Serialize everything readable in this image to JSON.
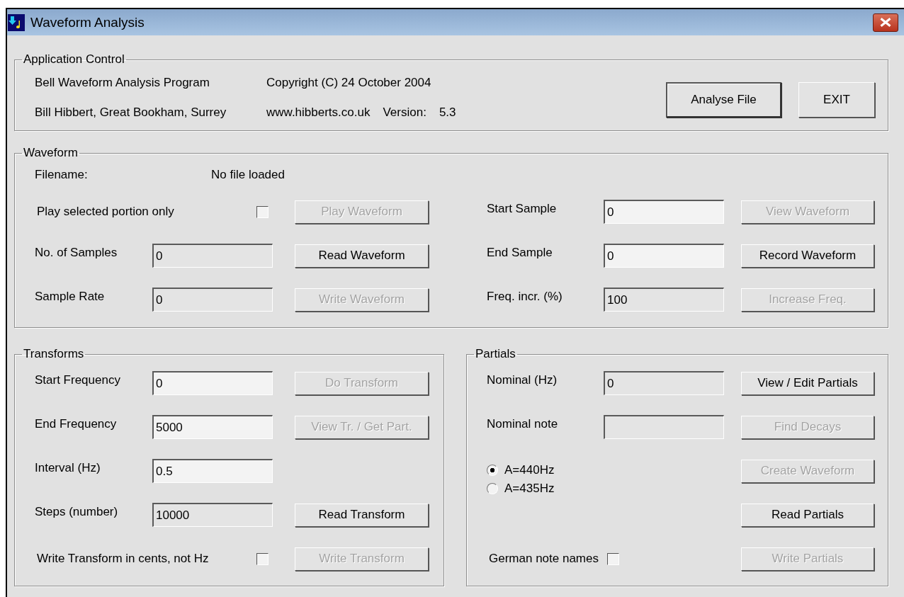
{
  "window": {
    "title": "Waveform Analysis"
  },
  "application_control": {
    "title": "Application Control",
    "program": "Bell Waveform Analysis Program",
    "copyright": "Copyright (C) 24 October 2004",
    "author": "Bill Hibbert, Great Bookham, Surrey",
    "website": "www.hibberts.co.uk",
    "version_label": "Version:",
    "version": "5.3",
    "buttons": [
      {
        "label": "Analyse File",
        "default": true
      },
      {
        "label": "EXIT",
        "default": false
      }
    ]
  },
  "waveform": {
    "title": "Waveform",
    "filename_label": "Filename:",
    "filename": "No file loaded",
    "left_rows": [
      {
        "kind": "checkbox",
        "label": "Play selected portion only",
        "checked": false,
        "button": {
          "label": "Play Waveform",
          "disabled": true
        }
      },
      {
        "kind": "field",
        "label": "No. of Samples",
        "value": "0",
        "disabled": true,
        "button": {
          "label": "Read Waveform",
          "disabled": false
        }
      },
      {
        "kind": "field",
        "label": "Sample Rate",
        "value": "0",
        "disabled": true,
        "button": {
          "label": "Write Waveform",
          "disabled": true
        }
      }
    ],
    "right_rows": [
      {
        "kind": "field",
        "label": "Start Sample",
        "value": "0",
        "disabled": false,
        "button": {
          "label": "View Waveform",
          "disabled": true
        }
      },
      {
        "kind": "field",
        "label": "End Sample",
        "value": "0",
        "disabled": false,
        "button": {
          "label": "Record Waveform",
          "disabled": false
        }
      },
      {
        "kind": "field",
        "label": "Freq. incr. (%)",
        "value": "100",
        "disabled": true,
        "button": {
          "label": "Increase Freq.",
          "disabled": true
        }
      }
    ]
  },
  "transforms": {
    "title": "Transforms",
    "rows": [
      {
        "kind": "field",
        "label": "Start Frequency",
        "value": "0",
        "disabled": false,
        "button": {
          "label": "Do Transform",
          "disabled": true
        }
      },
      {
        "kind": "field",
        "label": "End Frequency",
        "value": "5000",
        "disabled": false,
        "button": {
          "label": "View Tr. / Get Part.",
          "disabled": true
        }
      },
      {
        "kind": "field",
        "label": "Interval (Hz)",
        "value": "0.5",
        "disabled": false
      },
      {
        "kind": "field",
        "label": "Steps (number)",
        "value": "10000",
        "disabled": true,
        "button": {
          "label": "Read Transform",
          "disabled": false
        }
      },
      {
        "kind": "checkbox",
        "label": "Write Transform in cents, not Hz",
        "checked": false,
        "button": {
          "label": "Write Transform",
          "disabled": true
        }
      }
    ]
  },
  "partials": {
    "title": "Partials",
    "rows": [
      {
        "kind": "field",
        "label": "Nominal (Hz)",
        "value": "0",
        "disabled": true,
        "button": {
          "label": "View / Edit Partials",
          "disabled": false
        }
      },
      {
        "kind": "field",
        "label": "Nominal note",
        "disabled": true,
        "button": {
          "label": "Find Decays",
          "disabled": true
        }
      },
      {
        "kind": "radios",
        "options": [
          {
            "label": "A=440Hz",
            "selected": true
          },
          {
            "label": "A=435Hz",
            "selected": false
          }
        ],
        "button": {
          "label": "Create Waveform",
          "disabled": true
        }
      },
      {
        "kind": "blank",
        "button": {
          "label": "Read Partials",
          "disabled": false
        }
      },
      {
        "kind": "checkbox",
        "label": "German note names",
        "checked": false,
        "button": {
          "label": "Write Partials",
          "disabled": true
        }
      }
    ]
  }
}
